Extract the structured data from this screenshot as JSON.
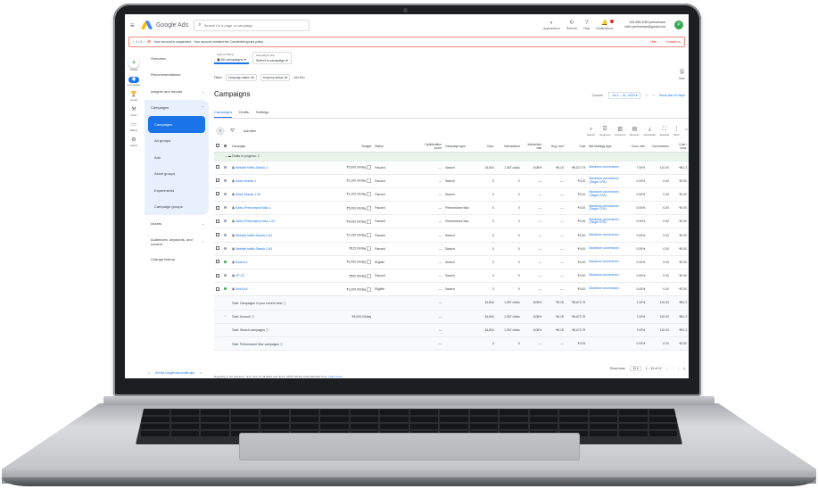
{
  "app": {
    "logo_text": "Google Ads",
    "search_placeholder": "Search for a page or campaign",
    "actions": [
      {
        "icon": "appearance-icon",
        "label": "Appearance",
        "glyph": "◐"
      },
      {
        "icon": "refresh-icon",
        "label": "Refresh",
        "glyph": "↻"
      },
      {
        "icon": "help-icon",
        "label": "Help",
        "glyph": "?"
      },
      {
        "icon": "bell-icon",
        "label": "Notifications",
        "glyph": "🔔"
      }
    ],
    "account_id": "163-565-2063 performaza",
    "account_email": "hello.performaza@gmail.com",
    "avatar_letter": "P"
  },
  "alert": {
    "message": "Your account is suspended · Your account violated the Counterfeit goods policy.",
    "hide": "Hide",
    "contact": "Contact us"
  },
  "rail": [
    {
      "icon": "plus-icon",
      "label": "Create"
    },
    {
      "icon": "campaigns-icon",
      "label": "Campaigns"
    },
    {
      "icon": "goals-icon",
      "label": "Goals"
    },
    {
      "icon": "tools-icon",
      "label": "Tools"
    },
    {
      "icon": "billing-icon",
      "label": "Billing"
    },
    {
      "icon": "admin-icon",
      "label": "Admin"
    }
  ],
  "nav": {
    "overview": "Overview",
    "recommendations": "Recommendations",
    "insights": "Insights and reports",
    "campaigns_group": "Campaigns",
    "campaigns": "Campaigns",
    "ad_groups": "Ad groups",
    "ads": "Ads",
    "asset_groups": "Asset groups",
    "experiments": "Experiments",
    "campaign_groups": "Campaign groups",
    "assets": "Assets",
    "audiences": "Audiences, keywords, and content",
    "change_history": "Change history",
    "footer": "Get the Google Ads mobile app"
  },
  "main": {
    "view_small": "View (2 filters)",
    "view_label": "All campaigns",
    "camp_small": "Campaigns (12)",
    "camp_label": "Select a campaign",
    "filters_label": "Filters",
    "filter_chips": [
      "Campaign status: All",
      "Ad group status: All"
    ],
    "add_filter_link": "Add filter",
    "save": "Save",
    "title": "Campaigns",
    "date_label": "Custom",
    "date_range": "Jul 1 – 31, 2024",
    "show_last": "Show last 30 days",
    "tabs": [
      "Campaigns",
      "Drafts",
      "Settings"
    ],
    "add_filter": "Add filter",
    "toolbar": [
      {
        "icon": "search-icon",
        "label": "Search",
        "glyph": "⌕"
      },
      {
        "icon": "segment-icon",
        "label": "Segment",
        "glyph": "☰"
      },
      {
        "icon": "columns-icon",
        "label": "Columns",
        "glyph": "▥"
      },
      {
        "icon": "reports-icon",
        "label": "Reports",
        "glyph": "▤"
      },
      {
        "icon": "download-icon",
        "label": "Download",
        "glyph": "⤓"
      },
      {
        "icon": "expand-icon",
        "label": "Expand",
        "glyph": "⛶"
      },
      {
        "icon": "more-icon",
        "label": "More",
        "glyph": "⋮"
      }
    ]
  },
  "table": {
    "headers": [
      "Campaign",
      "Budget",
      "Status",
      "Optimization score",
      "Campaign type",
      "Impr.",
      "Interactions",
      "Interaction rate",
      "Avg. cost",
      "Cost",
      "Bid strategy type",
      "Conv. rate",
      "Conversions",
      "Cost / conv."
    ],
    "group_label": "Drafts in progress: 2",
    "rows": [
      {
        "name": "Website traffic-Search-2",
        "budget": "₹5,000.00/day",
        "status": "Paused",
        "opt": "—",
        "type": "Search",
        "impr": "16,804",
        "inter": "1,357 clicks",
        "rate": "8.08%",
        "avg": "₹6.15",
        "cost": "₹8,672.79",
        "bid": "Maximize conversions",
        "conv_rate": "7.00%",
        "conv": "110.00",
        "cpc": "₹81.3",
        "dot": "#9aa0a6"
      },
      {
        "name": "Sales-Search-1",
        "budget": "₹2,100.00/day",
        "status": "Paused",
        "opt": "—",
        "type": "Search",
        "impr": "0",
        "inter": "0",
        "rate": "—",
        "avg": "—",
        "cost": "₹0.00",
        "bid": "Maximize conversions (Target CPA)",
        "conv_rate": "0.00%",
        "conv": "0.00",
        "cpc": "₹0.00",
        "dot": "#9aa0a6"
      },
      {
        "name": "Sales-Search-1 #2",
        "budget": "₹2,100.00/day",
        "status": "Paused",
        "opt": "—",
        "type": "Search",
        "impr": "0",
        "inter": "0",
        "rate": "—",
        "avg": "—",
        "cost": "₹0.00",
        "bid": "Maximize conversions (Target CPA)",
        "conv_rate": "0.00%",
        "conv": "0.00",
        "cpc": "₹0.00",
        "dot": "#9aa0a6"
      },
      {
        "name": "Sales-Performance Max-1",
        "budget": "₹5,000.00/day",
        "status": "Paused",
        "opt": "—",
        "type": "Performance Max",
        "impr": "0",
        "inter": "0",
        "rate": "—",
        "avg": "—",
        "cost": "₹0.00",
        "bid": "Maximize conversions (Target CPA)",
        "conv_rate": "0.00%",
        "conv": "0.00",
        "cpc": "₹0.00",
        "dot": "#9aa0a6"
      },
      {
        "name": "Sales-Performance Max-1 #2",
        "budget": "₹5,000.00/day",
        "status": "Paused",
        "opt": "—",
        "type": "Performance Max",
        "impr": "0",
        "inter": "0",
        "rate": "—",
        "avg": "—",
        "cost": "₹0.00",
        "bid": "Maximize conversions (Target CPA)",
        "conv_rate": "0.00%",
        "conv": "0.00",
        "cpc": "₹0.00",
        "dot": "#9aa0a6"
      },
      {
        "name": "Website traffic-Search-2 #2",
        "budget": "₹2,150.00/day",
        "status": "Paused",
        "opt": "—",
        "type": "Search",
        "impr": "0",
        "inter": "0",
        "rate": "—",
        "avg": "—",
        "cost": "₹0.00",
        "bid": "Maximize conversions",
        "conv_rate": "0.00%",
        "conv": "0.00",
        "cpc": "₹0.00",
        "dot": "#9aa0a6"
      },
      {
        "name": "Website traffic-Search-2 #3",
        "budget": "₹815.00/day",
        "status": "Paused",
        "opt": "—",
        "type": "Search",
        "impr": "0",
        "inter": "0",
        "rate": "—",
        "avg": "—",
        "cost": "₹0.00",
        "bid": "Maximize conversions",
        "conv_rate": "0.00%",
        "conv": "0.00",
        "cpc": "₹0.00",
        "dot": "#9aa0a6"
      },
      {
        "name": "Search-1",
        "budget": "₹4,000.00/day",
        "status": "Eligible",
        "opt": "—",
        "type": "Search",
        "impr": "0",
        "inter": "0",
        "rate": "—",
        "avg": "—",
        "cost": "₹0.00",
        "bid": "Maximize conversions",
        "conv_rate": "0.00%",
        "conv": "0.00",
        "cpc": "₹0.00",
        "dot": "#34a853"
      },
      {
        "name": "VP-Z2",
        "budget": "₹500.00/day",
        "status": "Paused",
        "opt": "—",
        "type": "Search",
        "impr": "0",
        "inter": "0",
        "rate": "—",
        "avg": "—",
        "cost": "₹0.00",
        "bid": "Maximize conversions",
        "conv_rate": "0.00%",
        "conv": "0.00",
        "cpc": "₹0.00",
        "dot": "#9aa0a6"
      },
      {
        "name": "Sea-Di-8",
        "budget": "₹1,000.00/day",
        "status": "Eligible",
        "opt": "—",
        "type": "Search",
        "impr": "0",
        "inter": "0",
        "rate": "—",
        "avg": "—",
        "cost": "₹0.00",
        "bid": "Maximize conversions",
        "conv_rate": "0.00%",
        "conv": "0.00",
        "cpc": "₹0.00",
        "dot": "#34a853"
      }
    ],
    "totals": [
      {
        "label": "Total: Campaigns in your current view",
        "budget": "",
        "opt": "—",
        "impr": "16,804",
        "inter": "1,357 clicks",
        "rate": "8.08%",
        "avg": "₹6.15",
        "cost": "₹8,672.79",
        "conv_rate": "7.00%",
        "conv": "110.00",
        "cpc": "₹81.3"
      },
      {
        "label": "Total: Account",
        "budget": "₹6,000.00/day",
        "opt": "—",
        "impr": "16,804",
        "inter": "1,357 clicks",
        "rate": "8.08%",
        "avg": "₹6.15",
        "cost": "₹8,672.79",
        "conv_rate": "7.00%",
        "conv": "110.00",
        "cpc": "₹81.3"
      },
      {
        "label": "Total: Search campaigns",
        "budget": "",
        "opt": "—",
        "impr": "16,804",
        "inter": "1,357 clicks",
        "rate": "8.08%",
        "avg": "₹6.15",
        "cost": "₹8,672.79",
        "conv_rate": "7.00%",
        "conv": "110.00",
        "cpc": "₹81.3"
      },
      {
        "label": "Total: Performance Max campaigns",
        "budget": "",
        "opt": "—",
        "impr": "0",
        "inter": "0",
        "rate": "—",
        "avg": "—",
        "cost": "₹0.00",
        "conv_rate": "0.00%",
        "conv": "0.00",
        "cpc": "₹0.00"
      }
    ],
    "pager_label": "Show rows:",
    "pager_size": "10",
    "pager_range": "1 – 10 of 12"
  },
  "footnote": {
    "text": "Reporting is not real-time. Time zone for all dates and times: (GMT+05:30) India Standard Time.",
    "link": "Learn more"
  },
  "colors": {
    "accent": "#1a73e8",
    "error": "#d93025",
    "eligible": "#34a853"
  }
}
